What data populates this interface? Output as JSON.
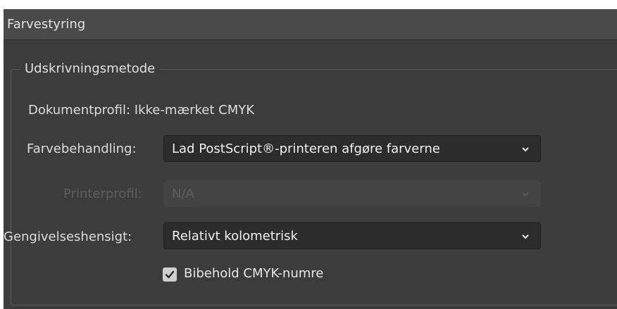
{
  "header": {
    "title": "Farvestyring"
  },
  "section": {
    "title": "Udskrivningsmetode"
  },
  "document_profile": {
    "text": "Dokumentprofil: Ikke-mærket CMYK"
  },
  "color_handling": {
    "label": "Farvebehandling:",
    "value": "Lad PostScript®-printeren afgøre farverne",
    "icon": "chevron-down-icon"
  },
  "printer_profile": {
    "label": "Printerprofil:",
    "value": "N/A",
    "disabled": true,
    "icon": "chevron-down-icon"
  },
  "rendering_intent": {
    "label": "Gengivelseshensigt:",
    "value": "Relativt kolometrisk",
    "icon": "chevron-down-icon"
  },
  "preserve_cmyk": {
    "label": "Bibehold CMYK-numre",
    "checked": true,
    "icon": "checkmark-icon"
  },
  "colors": {
    "background": "#3c3c3c",
    "header": "#4a4a4a",
    "control": "#2c2c2c",
    "text": "#dcdcdc",
    "disabled_text": "#5e5e5e"
  }
}
